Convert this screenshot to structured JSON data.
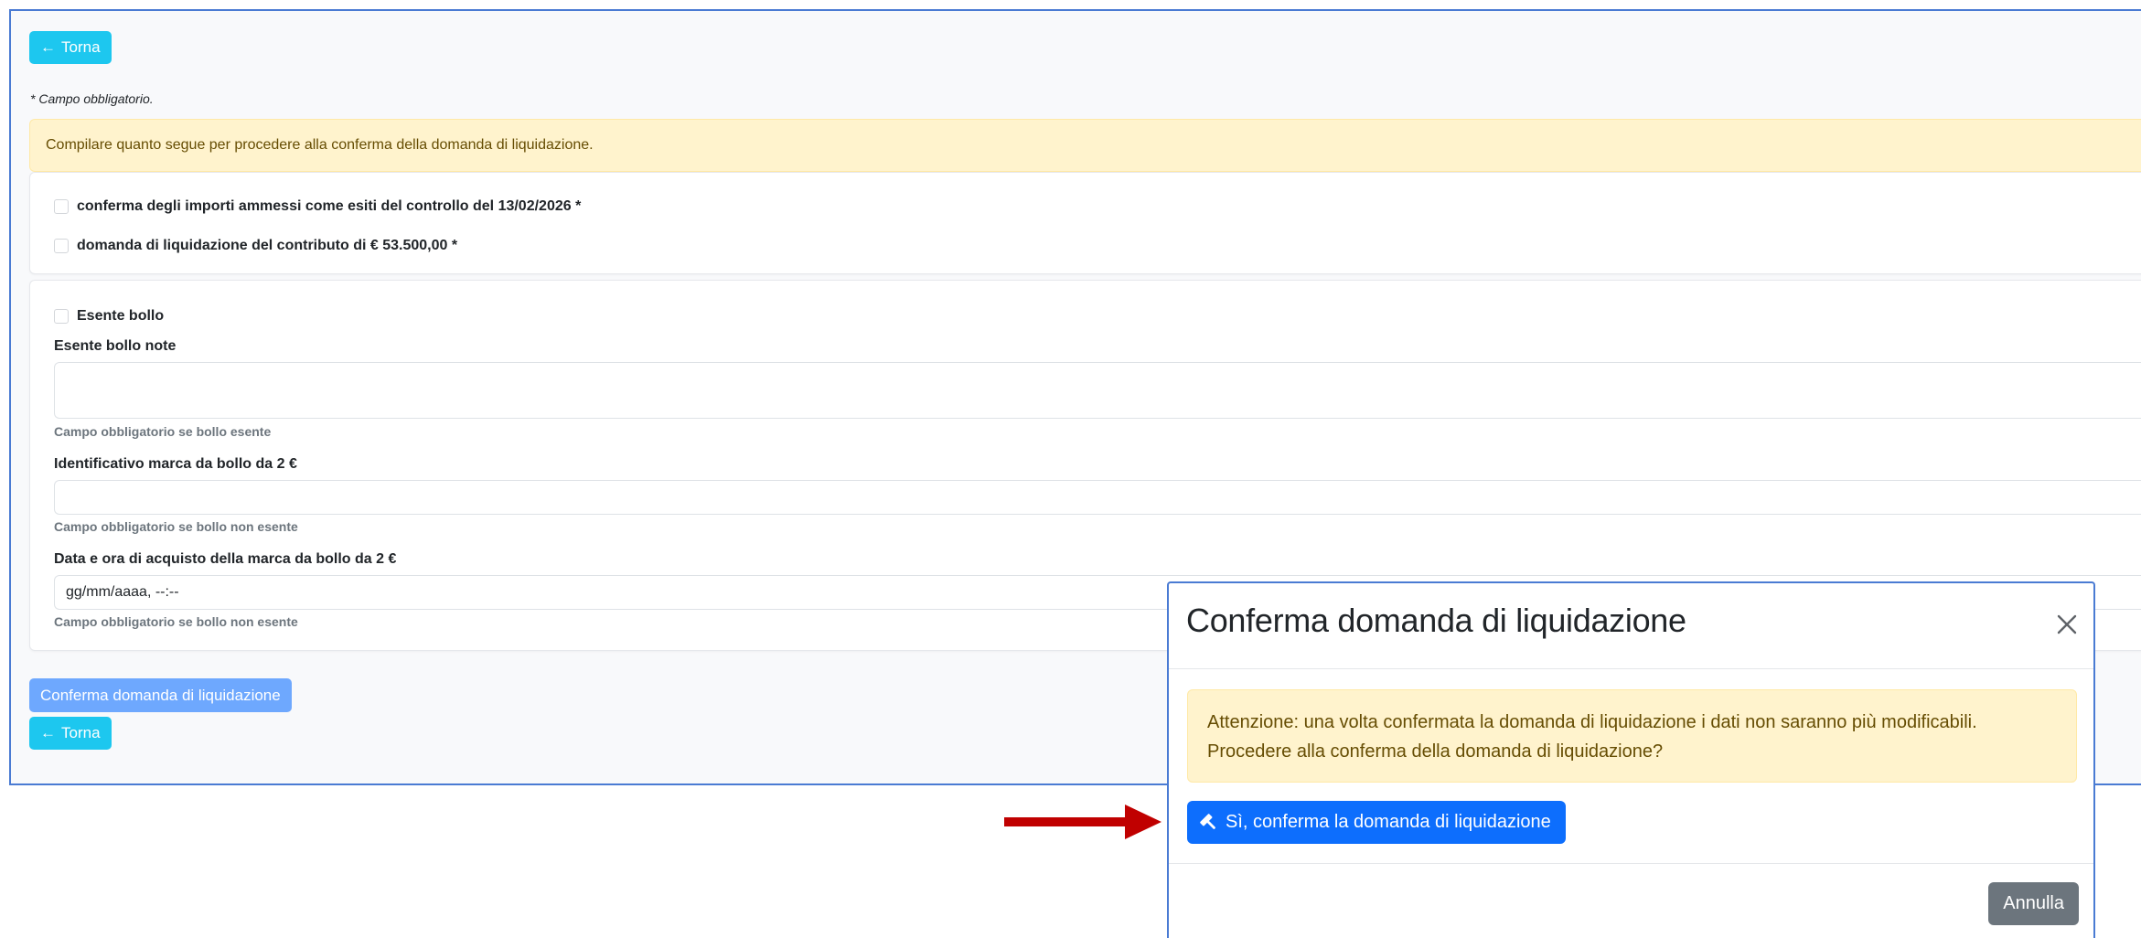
{
  "nav": {
    "back_label": "Torna"
  },
  "form": {
    "required_note": "* Campo obbligatorio.",
    "info_alert": "Compilare quanto segue per procedere alla conferma della domanda di liquidazione.",
    "checks": [
      {
        "label": "conferma degli importi ammessi come esiti del controllo del 13/02/2026 *",
        "checked": false
      },
      {
        "label": "domanda di liquidazione del contributo di € 53.500,00 *",
        "checked": false
      }
    ],
    "esente_bollo": {
      "label": "Esente bollo",
      "checked": false
    },
    "esente_note": {
      "label": "Esente bollo note",
      "value": "",
      "help": "Campo obbligatorio se bollo esente"
    },
    "marca_id": {
      "label": "Identificativo marca da bollo da 2 €",
      "value": "",
      "help": "Campo obbligatorio se bollo non esente"
    },
    "marca_data": {
      "label": "Data e ora di acquisto della marca da bollo da 2 €",
      "placeholder": "gg/mm/aaaa, --:--",
      "help": "Campo obbligatorio se bollo non esente"
    },
    "submit_label": "Conferma domanda di liquidazione"
  },
  "modal": {
    "title": "Conferma domanda di liquidazione",
    "alert_line1": "Attenzione: una volta confermata la domanda di liquidazione i dati non saranno più modificabili.",
    "alert_line2": "Procedere alla conferma della domanda di liquidazione?",
    "confirm_label": "Sì, conferma la domanda di liquidazione",
    "cancel_label": "Annulla"
  },
  "colors": {
    "info_button": "#1dc7ef",
    "primary": "#0d6efd",
    "primary_disabled": "#6ea8fe",
    "secondary": "#6c757d",
    "warning_bg": "#fff3cd",
    "annotation_arrow": "#c00000"
  },
  "icons": {
    "back": "arrow-left-icon",
    "confirm": "hammer-icon",
    "close": "close-icon"
  }
}
